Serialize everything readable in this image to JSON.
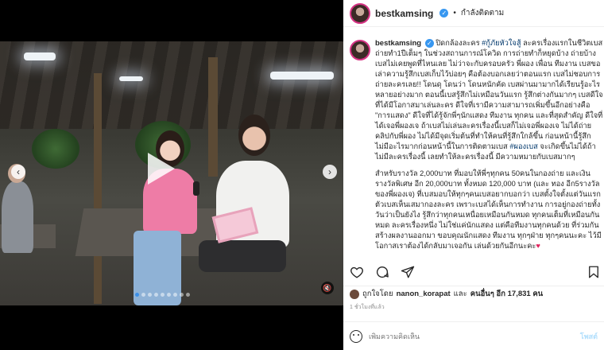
{
  "account": {
    "username": "bestkamsing",
    "follow_status": "กำลังติดตาม",
    "separator": "•"
  },
  "caption": {
    "username": "bestkamsing",
    "p1_part1": "ปิดกล้องละคร ",
    "hashtag1": "#กู้ภัยหัวใจสู้",
    "p1_part2": " ละครเรื่องแรกในชีวิตเบส ถ่ายทำ1ปีเต็มๆ ในช่วงสถานการณ์โควิด การถ่ายทำก็หยุดบ้าง ถ่ายบ้าง เบสไม่เคยพูดที่ไหนเลย ไม่ว่าจะกับครอบครัว พี่ผอง เพื่อน ทีมงาน เบสขอเล่าความรู้สึกเบสเก็บไว้บ่อยๆ คือต้องบอกเลยว่าตอนแรก เบสไม่ชอบการถ่ายละครเลย!! โดนดุ โดนว่า โดนหนักคัด เบสผ่านมามากได้เรียนรู้อะไรหลายอย่างมาก ตอนนี้เบสรู้สึกไม่เหมือนวันแรก รู้สึกต่างกันมากๆ เบสดีใจที่ได้มีโอกาสมาเล่นละคร ดีใจที่เรามีความสามารถเพิ่มขึ้นอีกอย่างคือ \"การแสดง\" ดีใจที่ได้รู้จักพี่ๆนักแสดง ทีมงาน ทุกคน และที่สุดสำคัญ ดีใจที่ได้เจอพี่ผองเจ ถ้าเบสไม่เล่นละครเรื่องนี้เบสก็ไม่เจอพี่ผองเจ ไม่ได้ถ่ายคลิปกับพี่ผอง ไม่ได้มีจุดเริ่มต้นที่ทำให้คนที่รู้สึกใกล้ขึ้น ก่อนหน้านี้รู้สึกไม่มีอะไรมากก่อนหน้านี้ในการติดตามเบส ",
    "hashtag2": "#ผองเบส",
    "p1_part3": " จะเกิดขึ้นไม่ได้ถ้าไม่มีละครเรื่องนี้ เลยทำให้ละครเรื่องนี้ มีความหมายกับเบสมากๆ",
    "p2": "สำหรับรางวัล 2,000บาท ที่มอบให้พี่ๆทุกคน 50คนในกองถ่าย และเงินรางวัลพิเศษ อีก 20,000บาท ทั้งหมด 120,000 บาท (และ ทอง อีก5รางวัลของพี่ผองเจ) ที่เบสมอบให้ทุกๆคนเบสอยากบอกว่า เบสตั้งใจตั้งแต่วันแรก ตัวเบสเห็นเสมากองละคร เพราะเบสได้เห็นการทำงาน การอยู่กองถ่ายทั้งวันว่าเป็นยังไง รู้สึกว่าทุกคนเหนื่อยเหมือนกันหมด ทุกคนเต็มที่เหมือนกันหมด ละครเรื่องหนึ่ง ไม่ใช่แค่นักแสดง แต่คือทีมงานทุกคนด้วย ที่ร่วมกันสร้างผลงานออกมา ขอบคุณนักแสดง ทีมงาน ทุกๆฝ่าย ทุกๆคนนะคะ ไว้มีโอกาสเราต้องได้กลับมาเจอกัน เล่นด้วยกันอีกนะคะ",
    "heart": "♥"
  },
  "likes": {
    "prefix": "ถูกใจโดย",
    "first_liker": "nanon_korapat",
    "and_text": "และ",
    "others_label": "คนอื่นๆ อีก 17,831 คน"
  },
  "timestamp": "1 ชั่วโมงที่แล้ว",
  "comment": {
    "placeholder": "เพิ่มความคิดเห็น",
    "post_label": "โพสต์"
  },
  "carousel": {
    "total_slides": 9,
    "active_slide": 1
  },
  "icons": {
    "play": "play-icon",
    "prev": "chevron-left-icon",
    "next": "chevron-right-icon",
    "mute": "speaker-muted-icon",
    "like": "heart-icon",
    "comment": "comment-icon",
    "share": "paper-plane-icon",
    "save": "bookmark-icon",
    "emoji": "smile-icon"
  },
  "colors": {
    "link": "#00376b",
    "verified": "#3897f0",
    "heart": "#e0245e",
    "post_disabled": "#b2dffc"
  }
}
